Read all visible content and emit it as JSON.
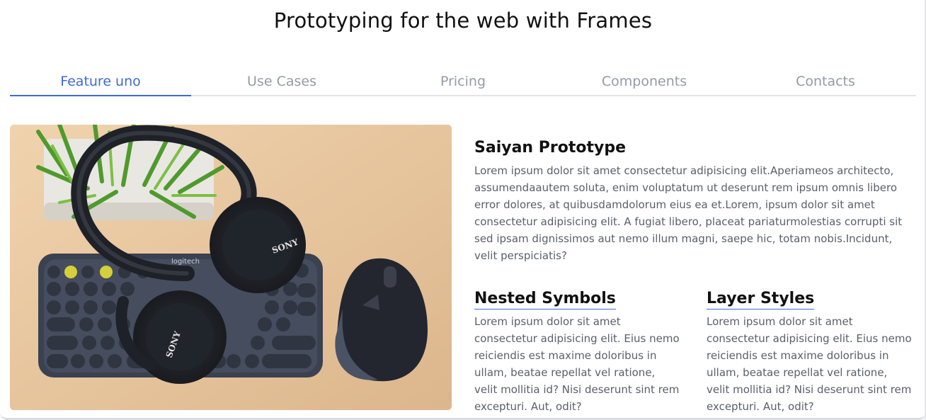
{
  "header": {
    "title": "Prototyping for the web with Frames"
  },
  "tabs": [
    {
      "label": "Feature uno",
      "active": true
    },
    {
      "label": "Use Cases",
      "active": false
    },
    {
      "label": "Pricing",
      "active": false
    },
    {
      "label": "Components",
      "active": false
    },
    {
      "label": "Contacts",
      "active": false
    }
  ],
  "hero_image": {
    "keyboard_brand": "logitech",
    "headphone_brand": "SONY"
  },
  "main": {
    "heading": "Saiyan Prototype",
    "body": "Lorem ipsum dolor sit amet consectetur adipisicing elit.Aperiameos architecto, assumendaautem soluta, enim voluptatum ut deserunt rem ipsum omnis libero error dolores, at quibusdamdolorum eius ea et.Lorem, ipsum dolor sit amet consectetur adipisicing elit. A fugiat libero, placeat pariaturmolestias corrupti sit sed ipsam dignissimos aut nemo illum magni, saepe hic, totam nobis.Incidunt, velit perspiciatis?"
  },
  "features": [
    {
      "heading": "Nested Symbols",
      "body": "Lorem ipsum dolor sit amet consectetur adipisicing elit. Eius nemo reiciendis est maxime doloribus in ullam, beatae repellat vel ratione, velit mollitia id? Nisi deserunt sint rem excepturi. Aut, odit?"
    },
    {
      "heading": "Layer Styles",
      "body": "Lorem ipsum dolor sit amet consectetur adipisicing elit. Eius nemo reiciendis est maxime doloribus in ullam, beatae repellat vel ratione, velit mollitia id? Nisi deserunt sint rem excepturi. Aut, odit?"
    }
  ],
  "colors": {
    "accent": "#3d6ad6",
    "tab_inactive": "#969aa7",
    "body_text": "#5b5f6b"
  }
}
